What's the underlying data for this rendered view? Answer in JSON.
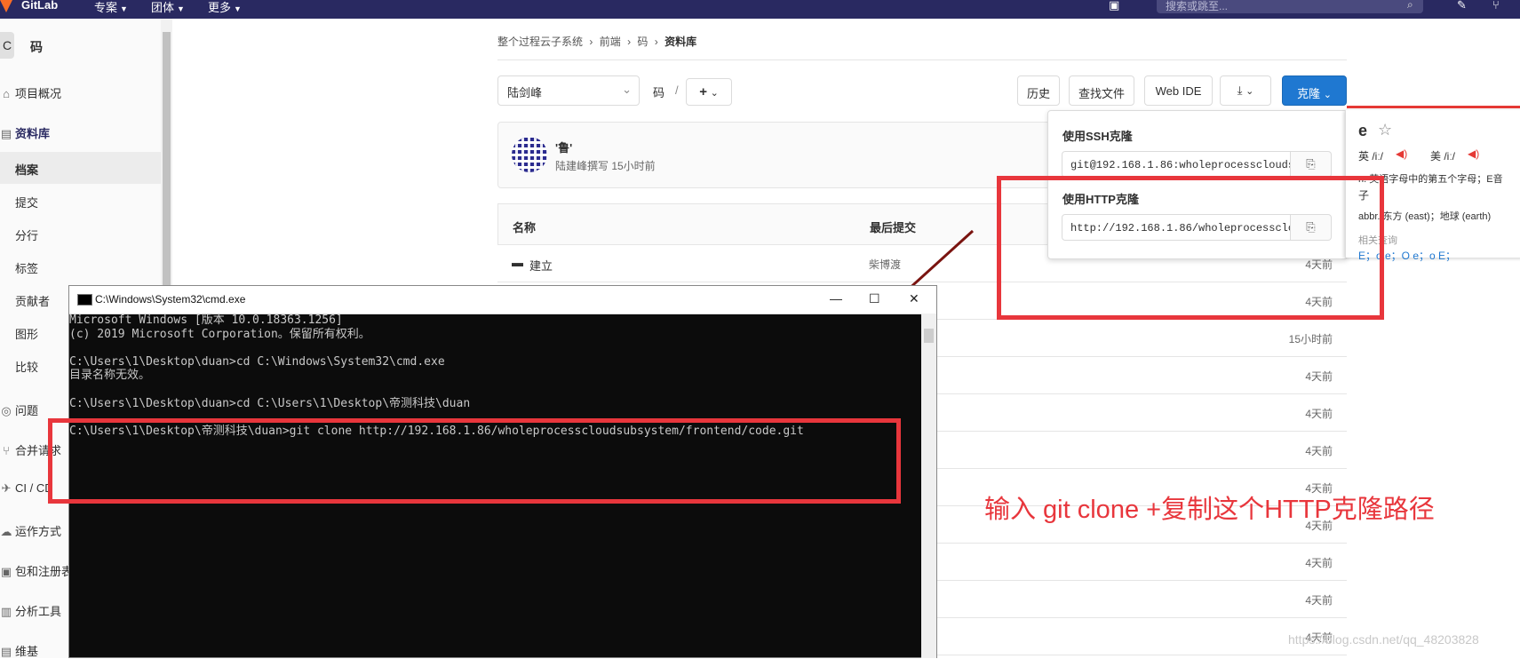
{
  "topnav": {
    "logo": "GitLab",
    "menu": [
      {
        "label": "专案"
      },
      {
        "label": "团体"
      },
      {
        "label": "更多"
      }
    ],
    "search_placeholder": "搜索或跳至..."
  },
  "sidebar": {
    "project_avatar": "C",
    "project_name": "码",
    "items": [
      {
        "label": "项目概况",
        "icon": "home-icon"
      },
      {
        "label": "资料库",
        "icon": "book-icon"
      },
      {
        "label": "档案"
      },
      {
        "label": "提交"
      },
      {
        "label": "分行"
      },
      {
        "label": "标签"
      },
      {
        "label": "贡献者"
      },
      {
        "label": "图形"
      },
      {
        "label": "比较"
      },
      {
        "label": "问题",
        "icon": "issues-icon"
      },
      {
        "label": "合并请求",
        "icon": "merge-icon"
      },
      {
        "label": "CI / CD",
        "icon": "rocket-icon"
      },
      {
        "label": "运作方式",
        "icon": "cloud-icon"
      },
      {
        "label": "包和注册表",
        "icon": "package-icon"
      },
      {
        "label": "分析工具",
        "icon": "chart-icon"
      },
      {
        "label": "维基",
        "icon": "book-icon"
      }
    ]
  },
  "breadcrumb": [
    "整个过程云子系统",
    "前端",
    "码",
    "资料库"
  ],
  "toolbar": {
    "branch": "陆剑峰",
    "path": "码",
    "path_sep": "/",
    "add_label": "+",
    "history": "历史",
    "find_file": "查找文件",
    "web_ide": "Web IDE",
    "clone": "克隆"
  },
  "commit": {
    "title": "'鲁'",
    "meta": "陆建峰撰写 15小时前"
  },
  "table": {
    "col_name": "名称",
    "col_last_commit": "最后提交",
    "first_row": {
      "name": "建立",
      "commit": "柴博渡"
    },
    "times": [
      "4天前",
      "4天前",
      "15小时前",
      "4天前",
      "4天前",
      "4天前",
      "4天前",
      "4天前",
      "4天前",
      "4天前",
      "4天前"
    ]
  },
  "clone_dropdown": {
    "ssh_label": "使用SSH克隆",
    "ssh_url": "git@192.168.1.86:wholeprocesscloudsubsystem/frontend/code.git",
    "http_label": "使用HTTP克隆",
    "http_url": "http://192.168.1.86/wholeprocesscloudsubsystem/frontend/code.git"
  },
  "dictionary": {
    "word": "e",
    "uk": "英 /iː/",
    "us": "美 /iː/",
    "def1": "n. 英语字母中的第五个字母；E音",
    "def1b": "子",
    "def2": "abbr. 东方 (east)；地球 (earth)",
    "related_label": "相关查询",
    "related": "E；o e；O e；o E；"
  },
  "cmd": {
    "title": "C:\\Windows\\System32\\cmd.exe",
    "lines": [
      "Microsoft Windows [版本 10.0.18363.1256]",
      "(c) 2019 Microsoft Corporation。保留所有权利。",
      "",
      "C:\\Users\\1\\Desktop\\duan>cd C:\\Windows\\System32\\cmd.exe",
      "目录名称无效。",
      "",
      "C:\\Users\\1\\Desktop\\duan>cd C:\\Users\\1\\Desktop\\帝测科技\\duan",
      "",
      "C:\\Users\\1\\Desktop\\帝测科技\\duan>git clone http://192.168.1.86/wholeprocesscloudsubsystem/frontend/code.git"
    ]
  },
  "annotation": "输入 git clone +复制这个HTTP克隆路径",
  "watermark": "https://blog.csdn.net/qq_48203828",
  "colors": {
    "nav": "#292961",
    "accent": "#1f78d1",
    "annotation_red": "#e8363c"
  }
}
